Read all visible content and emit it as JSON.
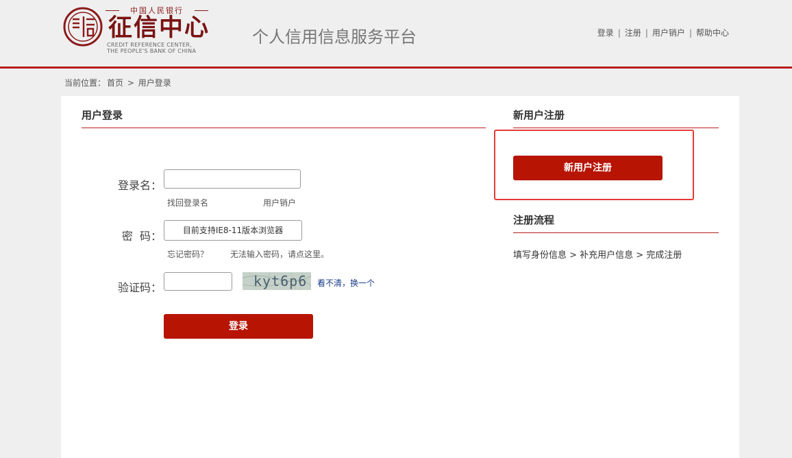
{
  "logo": {
    "upper_text": "中国人民银行",
    "main_text": "征信中心",
    "en_line1": "CREDIT REFERENCE CENTER,",
    "en_line2": "THE PEOPLE'S BANK OF CHINA",
    "brand_color": "#7a1313"
  },
  "header": {
    "platform_title": "个人信用信息服务平台"
  },
  "top_nav": {
    "items": [
      "登录",
      "注册",
      "用户销户",
      "帮助中心"
    ],
    "separator": "|"
  },
  "breadcrumb": {
    "prefix": "当前位置：",
    "home": "首页",
    "sep": ">",
    "current": "用户登录"
  },
  "login": {
    "title": "用户登录",
    "username_label": "登录名：",
    "username_value": "",
    "find_username": "找回登录名",
    "cancel_account": "用户销户",
    "password_label": "密  码：",
    "password_placeholder": "目前支持IE8-11版本浏览器",
    "forgot_password": "忘记密码？",
    "cannot_input": "无法输入密码，请点这里。",
    "captcha_label": "验证码：",
    "captcha_value": "",
    "captcha_text": "kyt6p6",
    "refresh_captcha": "看不清，换一个",
    "login_button": "登录"
  },
  "register": {
    "title": "新用户注册",
    "button": "新用户注册",
    "flow_title": "注册流程",
    "flow_text": "填写身份信息 > 补充用户信息 > 完成注册"
  },
  "colors": {
    "accent_red": "#b71404",
    "rule_red": "#b71c1c",
    "highlight": "#e53935",
    "link_blue": "#1a3c8a"
  }
}
